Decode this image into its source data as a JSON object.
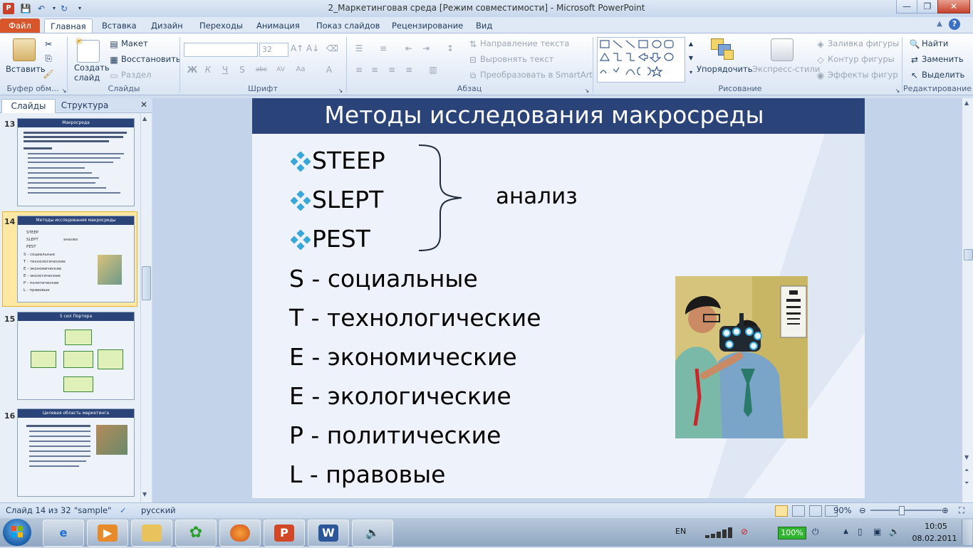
{
  "window": {
    "title": "2_Маркетинговая среда [Режим совместимости] - Microsoft PowerPoint"
  },
  "tabs": [
    {
      "label": "Файл"
    },
    {
      "label": "Главная"
    },
    {
      "label": "Вставка"
    },
    {
      "label": "Дизайн"
    },
    {
      "label": "Переходы"
    },
    {
      "label": "Анимация"
    },
    {
      "label": "Показ слайдов"
    },
    {
      "label": "Рецензирование"
    },
    {
      "label": "Вид"
    }
  ],
  "ribbon": {
    "clipboard": {
      "paste": "Вставить",
      "group": "Буфер обм..."
    },
    "slides": {
      "new_slide": "Создать слайд",
      "layout": "Макет",
      "reset": "Восстановить",
      "section": "Раздел",
      "group": "Слайды"
    },
    "font": {
      "font_size": "32",
      "group": "Шрифт",
      "buttons": [
        "Ж",
        "К",
        "Ч",
        "S",
        "abc",
        "AV",
        "Aa",
        "A"
      ]
    },
    "paragraph": {
      "text_direction": "Направление текста",
      "align_text": "Выровнять текст",
      "smartart": "Преобразовать в SmartArt",
      "group": "Абзац"
    },
    "drawing": {
      "arrange": "Упорядочить",
      "quick_styles": "Экспресс-стили",
      "fill": "Заливка фигуры",
      "outline": "Контур фигуры",
      "effects": "Эффекты фигур",
      "group": "Рисование"
    },
    "editing": {
      "find": "Найти",
      "replace": "Заменить",
      "select": "Выделить",
      "group": "Редактирование"
    }
  },
  "left_pane": {
    "tab_slides": "Слайды",
    "tab_outline": "Структура",
    "thumbnails": [
      {
        "num": "13",
        "title": "Макросреда"
      },
      {
        "num": "14",
        "title": "Методы исследования макросреды",
        "lines": [
          "STEEP",
          "SLEPT",
          "PEST",
          "анализ",
          "S - социальные",
          "T - технологические",
          "E - экономические",
          "E - экологические",
          "P - политические",
          "L - правовые"
        ]
      },
      {
        "num": "15",
        "title": "5 сил Портера"
      },
      {
        "num": "16",
        "title": "Целевая область маркетинга"
      }
    ]
  },
  "slide": {
    "title": "Методы исследования макросреды",
    "bullets": [
      "STEEP",
      "SLEPT",
      "PEST"
    ],
    "bracket_label": "анализ",
    "factors": [
      "S - социальные",
      "T - технологические",
      "E - экономические",
      "E - экологические",
      "P - политические",
      "L - правовые"
    ],
    "accent_color": "#2a4378",
    "bullet_color": "#3aa7d8"
  },
  "status": {
    "slide_info": "Слайд 14 из 32",
    "theme": "\"sample\"",
    "language": "русский",
    "zoom": "90%"
  },
  "taskbar": {
    "lang": "EN",
    "battery": "100%",
    "time": "10:05",
    "date": "08.02.2011"
  }
}
